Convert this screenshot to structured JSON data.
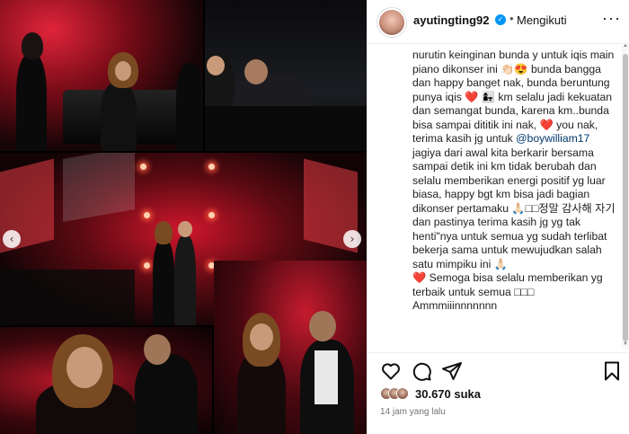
{
  "post": {
    "username": "ayutingting92",
    "verified_icon": "verified-badge-icon",
    "separator": "•",
    "follow_label": "Mengikuti",
    "more_label": "···",
    "caption": {
      "p1": "nurutin keinginan bunda y untuk iqis main piano dikonser ini 👏🏻😍 bunda bangga dan happy banget nak, bunda beruntung punya iqis ",
      "heart1": "❤️",
      "p2": " 👩‍👧 km selalu jadi kekuatan dan semangat bunda, karena km..bunda bisa sampai dititik ini nak, ",
      "heart2": "❤️",
      "p3": " you nak, terima kasih jg untuk ",
      "mention": "@boywilliam17",
      "p4": " jagiya dari awal kita berkarir bersama sampai detik ini km tidak berubah dan selalu memberikan energi positif yg luar biasa, happy bgt km bisa jadi bagian dikonser pertamaku 🙏🏻□□정말 감사해 자기 dan pastinya terima kasih jg yg tak henti\"nya untuk semua yg sudah terlibat  bekerja sama untuk mewujudkan salah satu mimpiku ini 🙏🏻\n",
      "heart3": "❤️",
      "p5": " Semoga bisa selalu memberikan yg terbaik untuk semua □□□\nAmmmiiinnnnnnn"
    },
    "likes_text": "30.670 suka",
    "time_text": "14 jam yang lalu"
  },
  "media": {
    "prev_arrow": "‹",
    "next_arrow": "›"
  },
  "icons": {
    "like": "heart-outline-icon",
    "comment": "comment-icon",
    "share": "share-icon",
    "save": "bookmark-icon"
  },
  "colors": {
    "verified": "#0095f6",
    "mention": "#00376b",
    "heart": "#e0242f",
    "muted": "#737373"
  }
}
